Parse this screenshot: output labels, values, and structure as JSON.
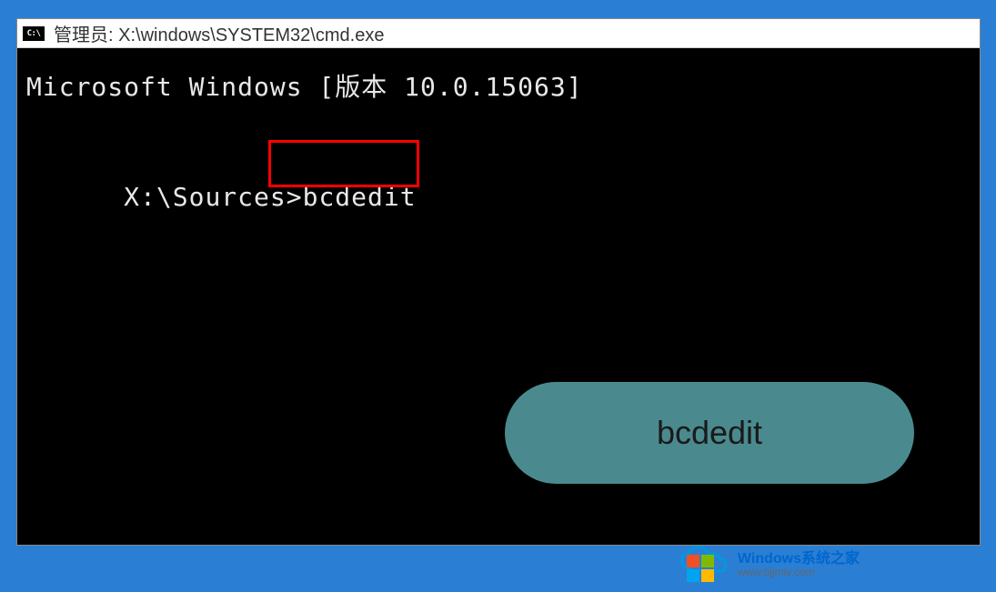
{
  "titlebar": {
    "icon_label": "C:\\",
    "text": "管理员: X:\\windows\\SYSTEM32\\cmd.exe"
  },
  "terminal": {
    "version_line": "Microsoft Windows [版本 10.0.15063]",
    "prompt": "X:\\Sources>",
    "command": "bcdedit"
  },
  "caption": {
    "label": "bcdedit"
  },
  "watermark": {
    "brand": "Windows",
    "slogan": "系统之家",
    "url": "www.bjjmlv.com"
  }
}
